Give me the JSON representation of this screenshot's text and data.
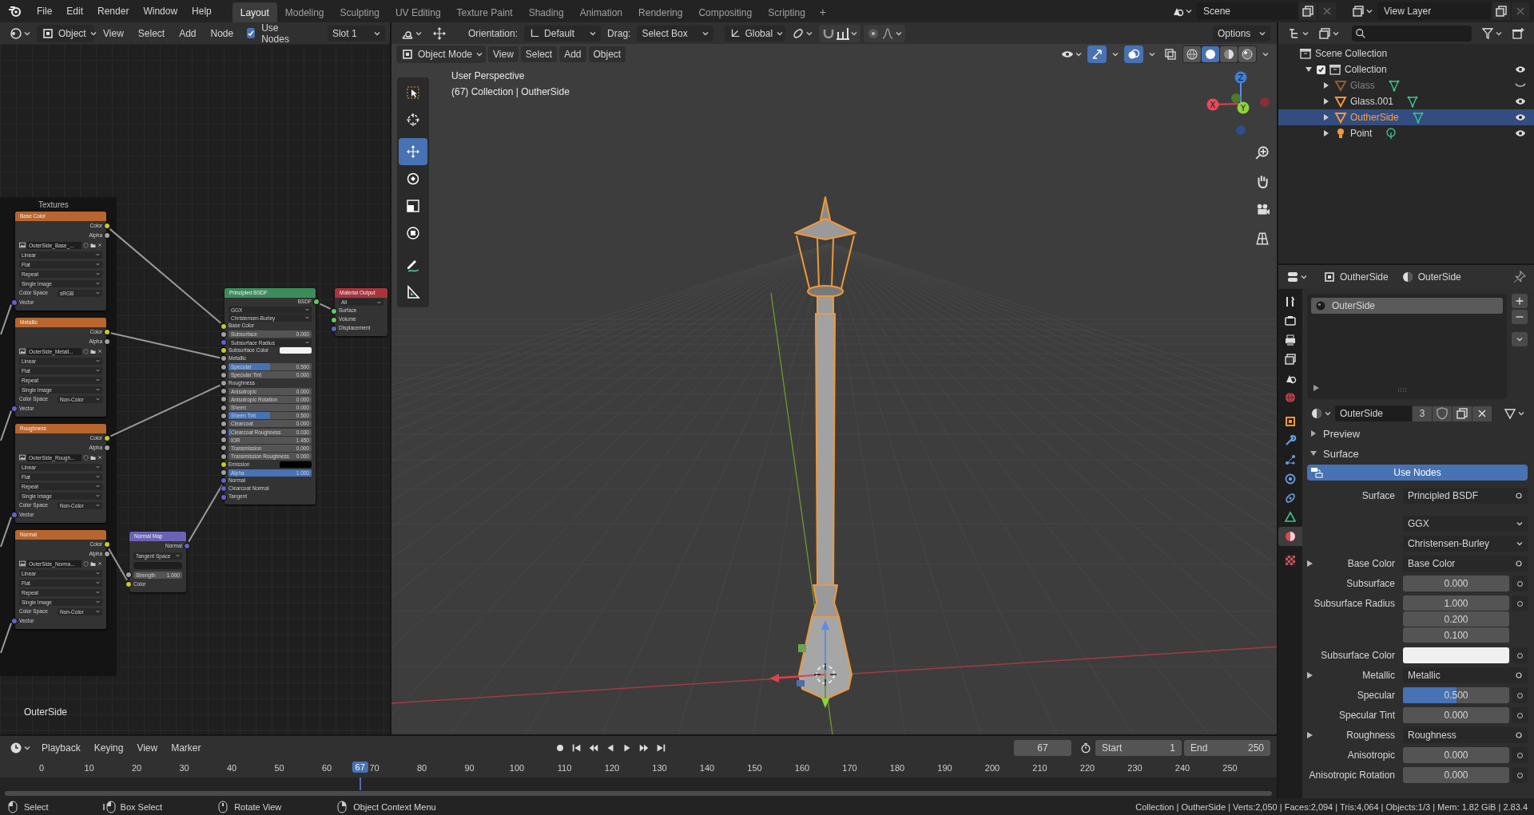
{
  "top_bar": {
    "menus": [
      "File",
      "Edit",
      "Render",
      "Window",
      "Help"
    ],
    "workspaces": [
      {
        "label": "Layout",
        "selected": true
      },
      {
        "label": "Modeling",
        "selected": false
      },
      {
        "label": "Sculpting",
        "selected": false
      },
      {
        "label": "UV Editing",
        "selected": false
      },
      {
        "label": "Texture Paint",
        "selected": false
      },
      {
        "label": "Shading",
        "selected": false
      },
      {
        "label": "Animation",
        "selected": false
      },
      {
        "label": "Rendering",
        "selected": false
      },
      {
        "label": "Compositing",
        "selected": false
      },
      {
        "label": "Scripting",
        "selected": false
      }
    ],
    "add_tab": "+",
    "scene": "Scene",
    "view_layer": "View Layer"
  },
  "node_editor": {
    "object": "Object",
    "menus": [
      "View",
      "Select",
      "Add",
      "Node"
    ],
    "use_nodes": {
      "label": "Use Nodes",
      "checked": true
    },
    "slot": "Slot 1",
    "frame_label": "Textures",
    "texture_nodes": [
      {
        "title": "Base Color",
        "outputs": [
          {
            "label": "Color",
            "socket": {
              "color": "#c7c729"
            }
          },
          {
            "label": "Alpha",
            "socket": {
              "color": "#a1a1a1"
            }
          }
        ],
        "image": "OuterSide_Base_...",
        "interpolation": "Linear",
        "projection": "Flat",
        "extension": "Repeat",
        "source": "Single Image",
        "color_space_label": "Color Space",
        "color_space": "sRGB",
        "input": {
          "label": "Vector",
          "socket": {
            "color": "#6363c7"
          }
        }
      },
      {
        "title": "Metallic",
        "outputs": [
          {
            "label": "Color",
            "socket": {
              "color": "#c7c729"
            }
          },
          {
            "label": "Alpha",
            "socket": {
              "color": "#a1a1a1"
            }
          }
        ],
        "image": "OuterSide_Metall...",
        "interpolation": "Linear",
        "projection": "Flat",
        "extension": "Repeat",
        "source": "Single Image",
        "color_space_label": "Color Space",
        "color_space": "Non-Color",
        "input": {
          "label": "Vector",
          "socket": {
            "color": "#6363c7"
          }
        }
      },
      {
        "title": "Roughness",
        "outputs": [
          {
            "label": "Color",
            "socket": {
              "color": "#c7c729"
            }
          },
          {
            "label": "Alpha",
            "socket": {
              "color": "#a1a1a1"
            }
          }
        ],
        "image": "OuterSide_Rough...",
        "interpolation": "Linear",
        "projection": "Flat",
        "extension": "Repeat",
        "source": "Single Image",
        "color_space_label": "Color Space",
        "color_space": "Non-Color",
        "input": {
          "label": "Vector",
          "socket": {
            "color": "#6363c7"
          }
        }
      },
      {
        "title": "Normal",
        "outputs": [
          {
            "label": "Color",
            "socket": {
              "color": "#c7c729"
            }
          },
          {
            "label": "Alpha",
            "socket": {
              "color": "#a1a1a1"
            }
          }
        ],
        "image": "OuterSide_Norma...",
        "interpolation": "Linear",
        "projection": "Flat",
        "extension": "Repeat",
        "source": "Single Image",
        "color_space_label": "Color Space",
        "color_space": "Non-Color",
        "input": {
          "label": "Vector",
          "socket": {
            "color": "#6363c7"
          }
        }
      }
    ],
    "normal_map": {
      "title": "Normal Map",
      "output": {
        "label": "Normal",
        "socket": {
          "color": "#6363c7"
        }
      },
      "space": "Tangent Space",
      "strength_label": "Strength",
      "strength": "1.000",
      "strength_socket": {
        "color": "#a1a1a1"
      },
      "input": {
        "label": "Color",
        "socket": {
          "color": "#c7c729"
        }
      }
    },
    "principled": {
      "title": "Principled BSDF",
      "output": {
        "label": "BSDF",
        "socket": {
          "color": "#63c763"
        }
      },
      "distribution": "GGX",
      "subsurface_method": "Christensen-Burley",
      "inputs": [
        {
          "label": "Base Color",
          "kind": "socket",
          "socket": {
            "color": "#c7c729"
          }
        },
        {
          "label": "Subsurface",
          "kind": "slider",
          "socket": {
            "color": "#a1a1a1"
          },
          "value": "0.000",
          "level": 0
        },
        {
          "label": "Subsurface Radius",
          "kind": "vector",
          "socket": {
            "color": "#6363c7"
          }
        },
        {
          "label": "Subsurface Color",
          "kind": "color",
          "socket": {
            "color": "#c7c729"
          },
          "color": "#f2f2f2"
        },
        {
          "label": "Metallic",
          "kind": "socket",
          "socket": {
            "color": "#a1a1a1"
          }
        },
        {
          "label": "Specular",
          "kind": "slider",
          "socket": {
            "color": "#a1a1a1"
          },
          "value": "0.500",
          "level": 0.5
        },
        {
          "label": "Specular Tint",
          "kind": "slider",
          "socket": {
            "color": "#a1a1a1"
          },
          "value": "0.000",
          "level": 0
        },
        {
          "label": "Roughness",
          "kind": "socket",
          "socket": {
            "color": "#a1a1a1"
          }
        },
        {
          "label": "Anisotropic",
          "kind": "slider",
          "socket": {
            "color": "#a1a1a1"
          },
          "value": "0.000",
          "level": 0
        },
        {
          "label": "Anisotropic Rotation",
          "kind": "slider",
          "socket": {
            "color": "#a1a1a1"
          },
          "value": "0.000",
          "level": 0
        },
        {
          "label": "Sheen",
          "kind": "slider",
          "socket": {
            "color": "#a1a1a1"
          },
          "value": "0.000",
          "level": 0
        },
        {
          "label": "Sheen Tint",
          "kind": "slider",
          "socket": {
            "color": "#a1a1a1"
          },
          "value": "0.500",
          "level": 0.5
        },
        {
          "label": "Clearcoat",
          "kind": "slider",
          "socket": {
            "color": "#a1a1a1"
          },
          "value": "0.000",
          "level": 0
        },
        {
          "label": "Clearcoat Roughness",
          "kind": "slider",
          "socket": {
            "color": "#a1a1a1"
          },
          "value": "0.030",
          "level": 0.03
        },
        {
          "label": "IOR",
          "kind": "number",
          "socket": {
            "color": "#a1a1a1"
          },
          "value": "1.450"
        },
        {
          "label": "Transmission",
          "kind": "slider",
          "socket": {
            "color": "#a1a1a1"
          },
          "value": "0.000",
          "level": 0
        },
        {
          "label": "Transmission Roughness",
          "kind": "slider",
          "socket": {
            "color": "#a1a1a1"
          },
          "value": "0.000",
          "level": 0
        },
        {
          "label": "Emission",
          "kind": "color",
          "socket": {
            "color": "#c7c729"
          },
          "color": "#000000"
        },
        {
          "label": "Alpha",
          "kind": "slider",
          "socket": {
            "color": "#a1a1a1"
          },
          "value": "1.000",
          "level": 1
        },
        {
          "label": "Normal",
          "kind": "socket",
          "socket": {
            "color": "#6363c7"
          }
        },
        {
          "label": "Clearcoat Normal",
          "kind": "socket",
          "socket": {
            "color": "#6363c7"
          }
        },
        {
          "label": "Tangent",
          "kind": "socket",
          "socket": {
            "color": "#6363c7"
          }
        }
      ]
    },
    "output": {
      "title": "Material Output",
      "target": "All",
      "inputs": [
        {
          "label": "Surface",
          "socket": {
            "color": "#63c763"
          }
        },
        {
          "label": "Volume",
          "socket": {
            "color": "#63c763"
          }
        },
        {
          "label": "Displacement",
          "socket": {
            "color": "#6363c7"
          }
        }
      ]
    },
    "material_label": "OuterSide"
  },
  "viewport": {
    "orientation_label": "Orientation:",
    "orientation": "Default",
    "drag_label": "Drag:",
    "drag": "Select Box",
    "transform": "Global",
    "options": "Options",
    "mode": "Object Mode",
    "menus": [
      "View",
      "Select",
      "Add",
      "Object"
    ],
    "tools": [
      {
        "kind": "select_box",
        "selected": false
      },
      {
        "kind": "cursor",
        "selected": false
      },
      {
        "kind": "move",
        "selected": true
      },
      {
        "kind": "rotate",
        "selected": false
      },
      {
        "kind": "scale",
        "selected": false
      },
      {
        "kind": "transform",
        "selected": false
      },
      {
        "kind": "annotate",
        "selected": false
      },
      {
        "kind": "measure",
        "selected": false
      }
    ],
    "shading": [
      {
        "kind": "wireframe",
        "selected": false
      },
      {
        "kind": "solid",
        "selected": true
      },
      {
        "kind": "material",
        "selected": false
      },
      {
        "kind": "rendered",
        "selected": false
      }
    ],
    "view_name": "User Perspective",
    "view_info": "(67) Collection | OutherSide",
    "gizmo": {
      "x": "X",
      "y": "Y",
      "z": "Z"
    }
  },
  "outliner": {
    "tree": [
      {
        "label": "Scene Collection",
        "kind": "scene_collection",
        "children": [
          {
            "label": "Collection",
            "kind": "collection",
            "expanded": true,
            "checked": true,
            "visible": true,
            "selected": false,
            "children": [
              {
                "label": "Glass",
                "kind": "mesh",
                "expanded": false,
                "visible": false,
                "selected": false
              },
              {
                "label": "Glass.001",
                "kind": "mesh",
                "expanded": false,
                "visible": true,
                "selected": false
              },
              {
                "label": "OutherSide",
                "kind": "mesh",
                "expanded": false,
                "visible": true,
                "selected": true
              },
              {
                "label": "Point",
                "kind": "light",
                "expanded": false,
                "visible": true,
                "selected": false
              }
            ]
          }
        ]
      }
    ]
  },
  "properties": {
    "object": "OutherSide",
    "material": "OuterSide",
    "tabs": [
      {
        "kind": "tool",
        "selected": false
      },
      {
        "kind": "render",
        "selected": false
      },
      {
        "kind": "output",
        "selected": false
      },
      {
        "kind": "view_layer",
        "selected": false
      },
      {
        "kind": "scene",
        "selected": false
      },
      {
        "kind": "world",
        "selected": false
      },
      {
        "kind": "object",
        "selected": false
      },
      {
        "kind": "modifiers",
        "selected": false
      },
      {
        "kind": "particles",
        "selected": false
      },
      {
        "kind": "physics",
        "selected": false
      },
      {
        "kind": "constraints",
        "selected": false
      },
      {
        "kind": "data",
        "selected": false
      },
      {
        "kind": "material",
        "selected": true
      },
      {
        "kind": "texture",
        "selected": false
      }
    ],
    "slots": [
      {
        "label": "OuterSide",
        "selected": true
      }
    ],
    "datablock": "OuterSide",
    "users": "3",
    "panels": [
      {
        "label": "Preview",
        "expanded": false
      },
      {
        "label": "Surface",
        "expanded": true
      }
    ],
    "use_nodes": "Use Nodes",
    "rows": [
      {
        "label": "Surface",
        "kind": "link",
        "value": "Principled BSDF",
        "expandable": false
      },
      {
        "kind": "dropdown",
        "value": "GGX",
        "expandable": false
      },
      {
        "kind": "dropdown",
        "value": "Christensen-Burley",
        "expandable": false
      },
      {
        "label": "Base Color",
        "kind": "link",
        "value": "Base Color",
        "expandable": true
      },
      {
        "label": "Subsurface",
        "kind": "slider",
        "value": "0.000",
        "level": 0,
        "expandable": false
      },
      {
        "label": "Subsurface Radius",
        "kind": "vector",
        "values": [
          "1.000",
          "0.200",
          "0.100"
        ],
        "expandable": false
      },
      {
        "label": "Subsurface Color",
        "kind": "color",
        "color": "#f0f0f0",
        "expandable": false
      },
      {
        "label": "Metallic",
        "kind": "link",
        "value": "Metallic",
        "expandable": true
      },
      {
        "label": "Specular",
        "kind": "slider",
        "value": "0.500",
        "level": 0.5,
        "expandable": false
      },
      {
        "label": "Specular Tint",
        "kind": "slider",
        "value": "0.000",
        "level": 0,
        "expandable": false
      },
      {
        "label": "Roughness",
        "kind": "link",
        "value": "Roughness",
        "expandable": true
      },
      {
        "label": "Anisotropic",
        "kind": "slider",
        "value": "0.000",
        "level": 0,
        "expandable": false
      },
      {
        "label": "Anisotropic Rotation",
        "kind": "slider",
        "value": "0.000",
        "level": 0,
        "expandable": false
      }
    ]
  },
  "timeline": {
    "menus": [
      "Playback",
      "Keying",
      "View",
      "Marker"
    ],
    "current_frame": "67",
    "start_label": "Start",
    "start": "1",
    "end_label": "End",
    "end": "250",
    "ticks": [
      "0",
      "10",
      "20",
      "30",
      "40",
      "50",
      "60",
      "70",
      "80",
      "90",
      "100",
      "110",
      "120",
      "130",
      "140",
      "150",
      "160",
      "170",
      "180",
      "190",
      "200",
      "210",
      "220",
      "230",
      "240",
      "250"
    ],
    "playhead": {
      "label": "67",
      "level": 0.268
    }
  },
  "status_bar": {
    "hints": [
      {
        "kind": "left",
        "label": "Select"
      },
      {
        "kind": "drag",
        "label": "Box Select"
      },
      {
        "kind": "middle",
        "label": "Rotate View"
      },
      {
        "kind": "right",
        "label": "Object Context Menu"
      }
    ],
    "stats": "Collection | OutherSide | Verts:2,050 | Faces:2,094 | Tris:4,064 | Objects:1/3 | Mem: 1.82 GiB | 2.83.4"
  }
}
